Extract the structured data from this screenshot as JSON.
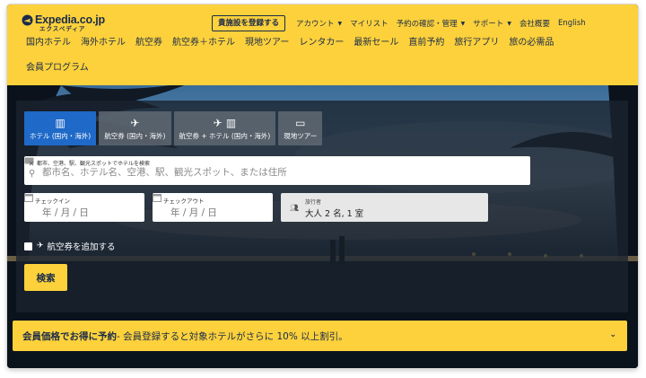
{
  "header": {
    "logo_text": "Expedia.co.jp",
    "logo_sub": "エクスペディア",
    "list_property_label": "貴施設を登録する",
    "top_links": [
      {
        "label": "アカウント",
        "dropdown": true
      },
      {
        "label": "マイリスト",
        "dropdown": false
      },
      {
        "label": "予約の確認・管理",
        "dropdown": true
      },
      {
        "label": "サポート",
        "dropdown": true
      },
      {
        "label": "会社概要",
        "dropdown": false
      },
      {
        "label": "English",
        "dropdown": false
      }
    ],
    "nav_items": [
      "国内ホテル",
      "海外ホテル",
      "航空券",
      "航空券＋ホテル",
      "現地ツアー",
      "レンタカー",
      "最新セール",
      "直前予約",
      "旅行アプリ",
      "旅の必需品",
      "会員プログラム"
    ]
  },
  "search": {
    "tabs": [
      {
        "icon": "hotel-icon",
        "glyph": "▥",
        "label": "ホテル (国内・海外)",
        "active": true
      },
      {
        "icon": "plane-icon",
        "glyph": "✈",
        "label": "航空券 (国内・海外)",
        "active": false
      },
      {
        "icon": "plane-hotel-icon",
        "glyph": "✈ ▥",
        "label": "航空券 + ホテル (国内・海外)",
        "active": false
      },
      {
        "icon": "ticket-icon",
        "glyph": "▭",
        "label": "現地ツアー",
        "active": false
      }
    ],
    "destination": {
      "label": "都市、空港、駅、観光スポットでホテルを検索",
      "placeholder": "都市名、ホテル名、空港、駅、観光スポット、または住所"
    },
    "checkin": {
      "label": "チェックイン",
      "value": "年 / 月 / 日"
    },
    "checkout": {
      "label": "チェックアウト",
      "value": "年 / 月 / 日"
    },
    "travelers": {
      "label": "旅行者",
      "value": "大人 2 名, 1 室"
    },
    "add_flight_label": "航空券を追加する",
    "search_button": "検索"
  },
  "promo": {
    "strong": "会員価格でお得に予約",
    "text": " - 会員登録すると対象ホテルがさらに 10% 以上割引。"
  },
  "colors": {
    "brand_yellow": "#fcd13b",
    "navy": "#1b2b4a",
    "active_tab": "#1f69c8"
  }
}
